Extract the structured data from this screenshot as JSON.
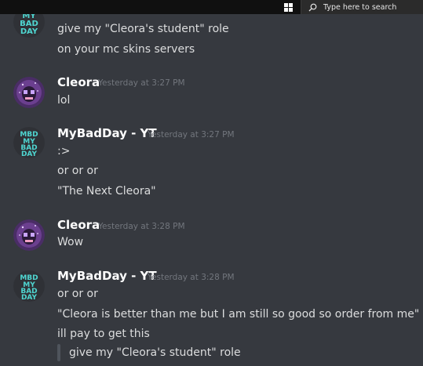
{
  "taskbar": {
    "search_placeholder": "Type here to search"
  },
  "messages": [
    {
      "author": "",
      "timestamp": "",
      "avatar": "mybadday-logo",
      "lines": [
        "give my \"Cleora's student\" role",
        "on your mc skins servers"
      ]
    },
    {
      "author": "Cleora",
      "timestamp": "Yesterday at 3:27 PM",
      "avatar": "cleora-avatar",
      "lines": [
        "lol"
      ]
    },
    {
      "author": "MyBadDay - YT",
      "timestamp": "Yesterday at 3:27 PM",
      "avatar": "mybadday-logo",
      "lines": [
        ":>",
        "or or or",
        "\"The Next Cleora\""
      ]
    },
    {
      "author": "Cleora",
      "timestamp": "Yesterday at 3:28 PM",
      "avatar": "cleora-avatar",
      "lines": [
        "Wow"
      ]
    },
    {
      "author": "MyBadDay - YT",
      "timestamp": "Yesterday at 3:28 PM",
      "avatar": "mybadday-logo",
      "lines": [
        "or or or",
        "\"Cleora is better than me but I am still so good so order from me\"",
        "ill pay to get this"
      ],
      "quote": "give my \"Cleora's student\" role"
    }
  ],
  "colors": {
    "background": "#36393f",
    "author": "#ffffff",
    "text": "#dcddde",
    "timestamp": "#72767d",
    "quote_bar": "#4f545c",
    "logo_teal": "#4fd6d1",
    "avatar_purple": "#5a3a7a"
  }
}
